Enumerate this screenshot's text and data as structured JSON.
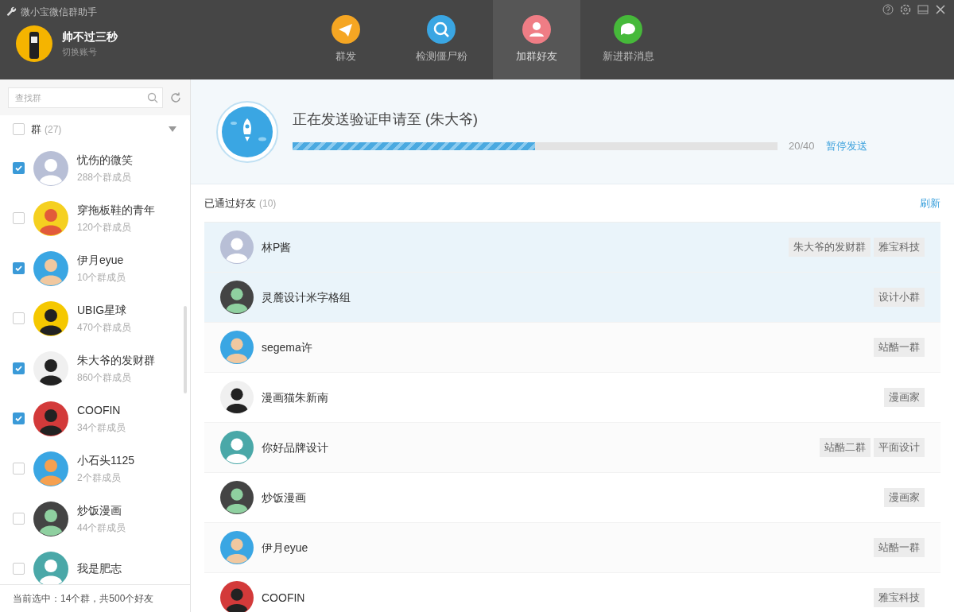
{
  "window": {
    "title": "微小宝微信群助手"
  },
  "account": {
    "name": "帅不过三秒",
    "action": "切换账号"
  },
  "tabs": [
    {
      "label": "群发",
      "selected": false
    },
    {
      "label": "检测僵尸粉",
      "selected": false
    },
    {
      "label": "加群好友",
      "selected": true
    },
    {
      "label": "新进群消息",
      "selected": false
    }
  ],
  "sidebar": {
    "search": {
      "placeholder": "查找群"
    },
    "group_header": {
      "label": "群",
      "count": "(27)",
      "checked": false
    },
    "groups": [
      {
        "name": "忧伤的微笑",
        "members": "288个群成员",
        "checked": true
      },
      {
        "name": "穿拖板鞋的青年",
        "members": "120个群成员",
        "checked": false
      },
      {
        "name": "伊月eyue",
        "members": "10个群成员",
        "checked": true
      },
      {
        "name": "UBIG星球",
        "members": "470个群成员",
        "checked": false
      },
      {
        "name": "朱大爷的发财群",
        "members": "860个群成员",
        "checked": true
      },
      {
        "name": "COOFIN",
        "members": "34个群成员",
        "checked": true
      },
      {
        "name": "小石头1125",
        "members": "2个群成员",
        "checked": false
      },
      {
        "name": "炒饭漫画",
        "members": "44个群成员",
        "checked": false
      },
      {
        "name": "我是肥志",
        "checked": false
      }
    ],
    "status": "当前选中：14个群，共500个好友"
  },
  "progress": {
    "title": "正在发送验证申请至 (朱大爷)",
    "level": 0.5,
    "reading": "20/40",
    "action": "暂停发送"
  },
  "friends": {
    "title": "已通过好友",
    "count": "(10)",
    "refresh": "刷新",
    "rows": [
      {
        "name": "林P酱",
        "tags": [
          "朱大爷的发财群",
          "雅宝科技"
        ],
        "selected": true
      },
      {
        "name": "灵麓设计米字格组",
        "tags": [
          "设计小群"
        ],
        "selected": true
      },
      {
        "name": "segema许",
        "tags": [
          "站酷一群"
        ],
        "selected": false
      },
      {
        "name": "漫画猫朱新南",
        "tags": [
          "漫画家"
        ],
        "selected": false
      },
      {
        "name": "你好品牌设计",
        "tags": [
          "站酷二群",
          "平面设计"
        ],
        "selected": false
      },
      {
        "name": "炒饭漫画",
        "tags": [
          "漫画家"
        ],
        "selected": false
      },
      {
        "name": "伊月eyue",
        "tags": [
          "站酷一群"
        ],
        "selected": false
      },
      {
        "name": "COOFIN",
        "tags": [
          "雅宝科技"
        ],
        "selected": false
      }
    ]
  }
}
